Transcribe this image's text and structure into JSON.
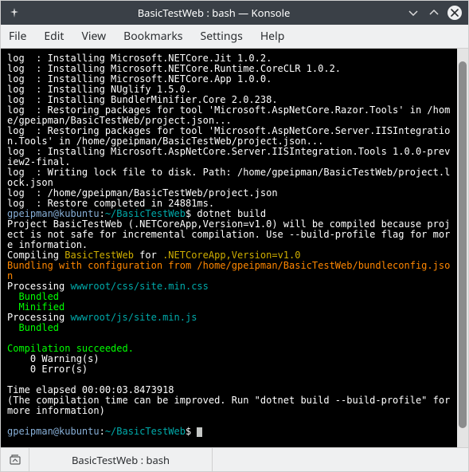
{
  "window": {
    "title": "BasicTestWeb : bash — Konsole"
  },
  "menu": {
    "items": [
      "File",
      "Edit",
      "View",
      "Bookmarks",
      "Settings",
      "Help"
    ]
  },
  "tabbar": {
    "active_tab": "BasicTestWeb : bash"
  },
  "colors": {
    "terminal_bg": "#000000",
    "terminal_fg": "#c5c8c6",
    "green": "#00ff00",
    "yellow": "#cfae00",
    "cyan": "#00aaaa",
    "orange": "#ff8700",
    "prompt": "#87afd7"
  },
  "terminal": {
    "prompt": "gpeipman@kubuntu:~/BasicTestWeb$",
    "prompt_cmd": " dotnet build",
    "lines": [
      [
        [
          "w",
          "log  : Installing Microsoft.NETCore.Jit 1.0.2."
        ]
      ],
      [
        [
          "w",
          "log  : Installing Microsoft.NETCore.Runtime.CoreCLR 1.0.2."
        ]
      ],
      [
        [
          "w",
          "log  : Installing Microsoft.NETCore.App 1.0.0."
        ]
      ],
      [
        [
          "w",
          "log  : Installing NUglify 1.5.0."
        ]
      ],
      [
        [
          "w",
          "log  : Installing BundlerMinifier.Core 2.0.238."
        ]
      ],
      [
        [
          "w",
          "log  : Restoring packages for tool 'Microsoft.AspNetCore.Razor.Tools' in /home/gpeipman/BasicTestWeb/project.json..."
        ]
      ],
      [
        [
          "w",
          "log  : Restoring packages for tool 'Microsoft.AspNetCore.Server.IISIntegration.Tools' in /home/gpeipman/BasicTestWeb/project.json..."
        ]
      ],
      [
        [
          "w",
          "log  : Installing Microsoft.AspNetCore.Server.IISIntegration.Tools 1.0.0-preview2-final."
        ]
      ],
      [
        [
          "w",
          "log  : Writing lock file to disk. Path: /home/gpeipman/BasicTestWeb/project.lock.json"
        ]
      ],
      [
        [
          "w",
          "log  : /home/gpeipman/BasicTestWeb/project.json"
        ]
      ],
      [
        [
          "w",
          "log  : Restore completed in 24881ms."
        ]
      ],
      [
        [
          "p",
          "gpeipman@kubuntu"
        ],
        [
          "w",
          ":"
        ],
        [
          "c",
          "~/BasicTestWeb"
        ],
        [
          "w",
          "$ dotnet build"
        ]
      ],
      [
        [
          "w",
          "Project BasicTestWeb (.NETCoreApp,Version=v1.0) will be compiled because project is not safe for incremental compilation. Use --build-profile flag for more information."
        ]
      ],
      [
        [
          "w",
          "Compiling "
        ],
        [
          "y",
          "BasicTestWeb"
        ],
        [
          "w",
          " for "
        ],
        [
          "y",
          ".NETCoreApp,Version=v1.0"
        ]
      ],
      [
        [
          "o",
          "Bundling with configuration from /home/gpeipman/BasicTestWeb/bundleconfig.json"
        ]
      ],
      [
        [
          "w",
          "Processing "
        ],
        [
          "c",
          "wwwroot/css/site.min.css"
        ]
      ],
      [
        [
          "g",
          "  Bundled"
        ]
      ],
      [
        [
          "g",
          "  Minified"
        ]
      ],
      [
        [
          "w",
          "Processing "
        ],
        [
          "c",
          "wwwroot/js/site.min.js"
        ]
      ],
      [
        [
          "g",
          "  Bundled"
        ]
      ],
      [
        [
          "w",
          ""
        ]
      ],
      [
        [
          "g",
          "Compilation succeeded."
        ]
      ],
      [
        [
          "w",
          "    0 Warning(s)"
        ]
      ],
      [
        [
          "w",
          "    0 Error(s)"
        ]
      ],
      [
        [
          "w",
          ""
        ]
      ],
      [
        [
          "w",
          "Time elapsed 00:00:03.8473918"
        ]
      ],
      [
        [
          "w",
          "(The compilation time can be improved. Run \"dotnet build --build-profile\" for more information)"
        ]
      ],
      [
        [
          "w",
          " "
        ]
      ]
    ]
  }
}
